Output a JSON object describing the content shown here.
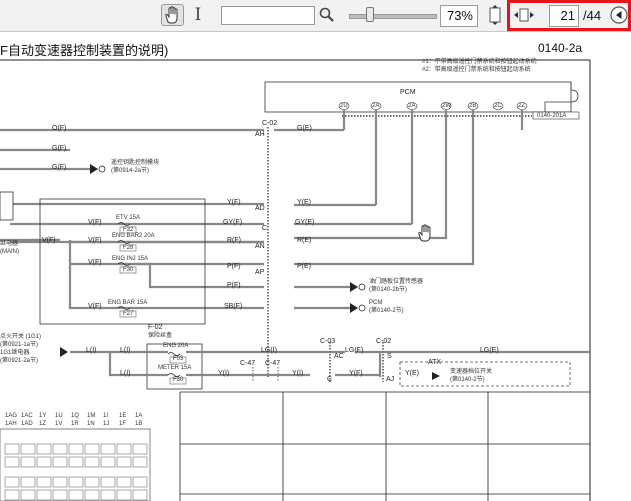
{
  "toolbar": {
    "zoom_value": "73%",
    "page_current": "21",
    "page_total": "/44"
  },
  "document": {
    "title": "F自动变速器控制装置的说明)",
    "code": "0140-2a",
    "notes": [
      "#1：不带高级遥控门禁系统和按钮起动系统",
      "#2：带高级遥控门禁系统和按钮起动系统"
    ],
    "pcm_label": "PCM",
    "pcm_code": "0140-201A",
    "pcm_pins": [
      "2U",
      "2A",
      "2A",
      "2W",
      "2B",
      "2C",
      "2Z"
    ],
    "conn_c02_top": "C-02",
    "conn_ah": "AH",
    "conn_ad": "AD",
    "conn_c": "C",
    "conn_an": "AN",
    "conn_ap": "AP",
    "wire_left_top": [
      "O(F)",
      "G(F)",
      "G(F)"
    ],
    "wire_ge": "G(E)",
    "ye_wire": "Y(F)",
    "ye_wire_r": "Y(E)",
    "gy_wire": "GY(F)",
    "gy_wire_r": "GY(E)",
    "r_wire": "R(F)",
    "r_wire_r": "R(E)",
    "p_wire": "P(F)",
    "p_wire_r": "P(E)",
    "p_wire2": "P(F)",
    "sb_wire": "SB(F)",
    "v_wire1": "V(F)",
    "v_wire2": "V(F)",
    "v_wire3": "V(F)",
    "v_wire4": "V(F)",
    "v_wire5": "V(F)",
    "keyless_label": "遥控钥匙控制模块",
    "keyless_ref": "(第0914-2a节)",
    "fuse_etv": "ETV 15A",
    "fuse_etv_id": "F32",
    "fuse_engbar20": "ENG BAR2 20A",
    "fuse_engbar20_id": "F28",
    "fuse_enginj": "ENG INJ 15A",
    "fuse_enginj_id": "F30",
    "fuse_engbar15": "ENG BAR 15A",
    "fuse_engbar15_id": "F27",
    "relay_label": "继电器",
    "relay_main": "(MAIN)",
    "tps_label": "油门踏板位置传感器",
    "tps_ref": "(第0140-2b节)",
    "pcm_ref_label": "PCM",
    "pcm_ref": "(第0140-2节)",
    "ign_label": "点火开关 (1G1)",
    "ign_ref": "(第0921-1a节)",
    "relay2_label": "1G1继电器",
    "relay2_ref": "(第0921-2a节)",
    "f02_label": "F-02",
    "fusebox_label": "保险丝盒",
    "fuse_eng20": "ENG 20A",
    "fuse_eng20_id": "F03",
    "fuse_meter": "METER 15A",
    "fuse_meter_id": "F30",
    "lg_wire": "LG(I)",
    "lg_wire_f": "LG(F)",
    "lg_wire_e": "LG(E)",
    "li_wire": "L(I)",
    "li_wire2": "L(I)",
    "li_wire3": "L(I)",
    "yi_wire": "Y(I)",
    "yi_wire2": "Y(I)",
    "yf_wire": "Y(F)",
    "yf_wire_e": "Y(E)",
    "c03": "C-03",
    "c02b": "C-02",
    "c47a": "C-47",
    "c47b": "C-47",
    "conn_ac": "AC",
    "conn_aj": "AJ",
    "conn_s": "S",
    "conn_c2": "C",
    "atx_label": "ATX",
    "range_label": "变速器档位开关",
    "range_ref": "(第0140-2节)",
    "connector_pins_top": [
      "1AG",
      "1AC",
      "1Y",
      "1U",
      "1Q",
      "1M",
      "1I",
      "1E",
      "1A"
    ],
    "connector_pins_bot": [
      "1AH",
      "1AD",
      "1Z",
      "1V",
      "1R",
      "1N",
      "1J",
      "1F",
      "1B"
    ]
  }
}
